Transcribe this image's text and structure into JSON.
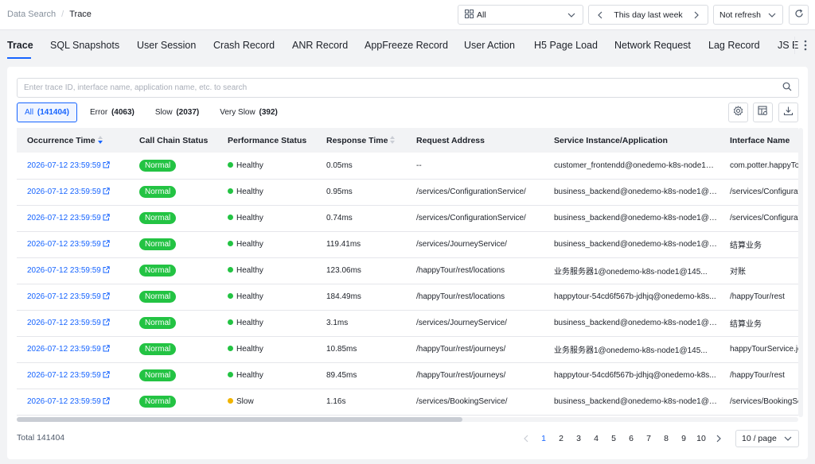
{
  "breadcrumb": {
    "parent": "Data Search",
    "separator": "/",
    "current": "Trace"
  },
  "controls": {
    "app_select": "All",
    "time_range": "This day last week",
    "refresh": "Not refresh"
  },
  "tabs": [
    "Trace",
    "SQL Snapshots",
    "User Session",
    "Crash Record",
    "ANR Record",
    "AppFreeze Record",
    "User Action",
    "H5 Page Load",
    "Network Request",
    "Lag Record",
    "JS E"
  ],
  "search": {
    "placeholder": "Enter trace ID, interface name, application name, etc. to search",
    "value": ""
  },
  "filters": [
    {
      "label": "All",
      "count": "(141404)",
      "active": true
    },
    {
      "label": "Error",
      "count": "(4063)",
      "active": false
    },
    {
      "label": "Slow",
      "count": "(2037)",
      "active": false
    },
    {
      "label": "Very Slow",
      "count": "(392)",
      "active": false
    }
  ],
  "table": {
    "columns": [
      "Occurrence Time",
      "Call Chain Status",
      "Performance Status",
      "Response Time",
      "Request Address",
      "Service Instance/Application",
      "Interface Name"
    ],
    "rows": [
      {
        "time": "2026-07-12 23:59:59",
        "chain": "Normal",
        "perf": "Healthy",
        "perf_color": "#23c343",
        "resp": "0.05ms",
        "addr": "--",
        "svc": "customer_frontendd@onedemo-k8s-node1@...",
        "iface": "com.potter.happyTour"
      },
      {
        "time": "2026-07-12 23:59:59",
        "chain": "Normal",
        "perf": "Healthy",
        "perf_color": "#23c343",
        "resp": "0.95ms",
        "addr": "/services/ConfigurationService/",
        "svc": "business_backend@onedemo-k8s-node1@145...",
        "iface": "/services/ConfigurationService"
      },
      {
        "time": "2026-07-12 23:59:59",
        "chain": "Normal",
        "perf": "Healthy",
        "perf_color": "#23c343",
        "resp": "0.74ms",
        "addr": "/services/ConfigurationService/",
        "svc": "business_backend@onedemo-k8s-node1@145...",
        "iface": "/services/ConfigurationService"
      },
      {
        "time": "2026-07-12 23:59:59",
        "chain": "Normal",
        "perf": "Healthy",
        "perf_color": "#23c343",
        "resp": "119.41ms",
        "addr": "/services/JourneyService/",
        "svc": "business_backend@onedemo-k8s-node1@145...",
        "iface": "结算业务"
      },
      {
        "time": "2026-07-12 23:59:59",
        "chain": "Normal",
        "perf": "Healthy",
        "perf_color": "#23c343",
        "resp": "123.06ms",
        "addr": "/happyTour/rest/locations",
        "svc": "业务服务器1@onedemo-k8s-node1@145...",
        "iface": "对账"
      },
      {
        "time": "2026-07-12 23:59:59",
        "chain": "Normal",
        "perf": "Healthy",
        "perf_color": "#23c343",
        "resp": "184.49ms",
        "addr": "/happyTour/rest/locations",
        "svc": "happytour-54cd6f567b-jdhjq@onedemo-k8s...",
        "iface": "/happyTour/rest"
      },
      {
        "time": "2026-07-12 23:59:59",
        "chain": "Normal",
        "perf": "Healthy",
        "perf_color": "#23c343",
        "resp": "3.1ms",
        "addr": "/services/JourneyService/",
        "svc": "business_backend@onedemo-k8s-node1@145...",
        "iface": "结算业务"
      },
      {
        "time": "2026-07-12 23:59:59",
        "chain": "Normal",
        "perf": "Healthy",
        "perf_color": "#23c343",
        "resp": "10.85ms",
        "addr": "/happyTour/rest/journeys/",
        "svc": "业务服务器1@onedemo-k8s-node1@145...",
        "iface": "happyTourService.journeys"
      },
      {
        "time": "2026-07-12 23:59:59",
        "chain": "Normal",
        "perf": "Healthy",
        "perf_color": "#23c343",
        "resp": "89.45ms",
        "addr": "/happyTour/rest/journeys/",
        "svc": "happytour-54cd6f567b-jdhjq@onedemo-k8s...",
        "iface": "/happyTour/rest"
      },
      {
        "time": "2026-07-12 23:59:59",
        "chain": "Normal",
        "perf": "Slow",
        "perf_color": "#f0b400",
        "resp": "1.16s",
        "addr": "/services/BookingService/",
        "svc": "business_backend@onedemo-k8s-node1@145...",
        "iface": "/services/BookingService"
      }
    ]
  },
  "footer": {
    "total": "Total 141404",
    "pages": [
      "1",
      "2",
      "3",
      "4",
      "5",
      "6",
      "7",
      "8",
      "9",
      "10"
    ],
    "current_page": "1",
    "page_size": "10 / page"
  },
  "colors": {
    "accent": "#1664ff",
    "healthy": "#23c343",
    "slow": "#f0b400"
  },
  "icons": [
    "app-grid-icon",
    "chevron-down-icon",
    "chevron-left-icon",
    "chevron-right-icon",
    "reload-icon",
    "more-vertical-icon",
    "search-icon",
    "settings-icon",
    "column-settings-icon",
    "download-icon",
    "external-link-icon",
    "sort-icon"
  ]
}
